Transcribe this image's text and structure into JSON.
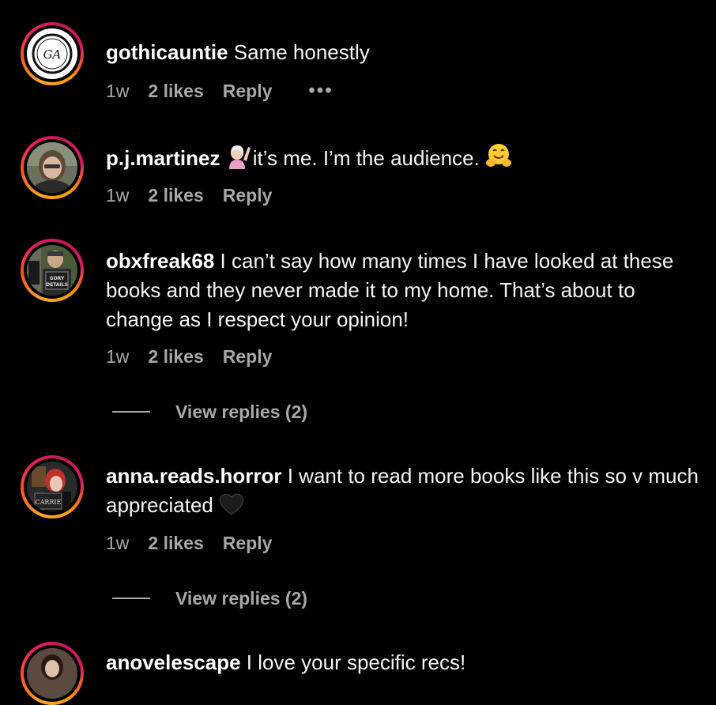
{
  "comments": [
    {
      "username": "gothicauntie",
      "text": " Same honestly",
      "time": "1w",
      "likes": "2 likes",
      "reply": "Reply",
      "more": "•••",
      "avatar_initials": "GA"
    },
    {
      "username": "p.j.martinez",
      "text_before_emoji": " ",
      "text": "it’s me. I’m the audience. ",
      "time": "1w",
      "likes": "2 likes",
      "reply": "Reply",
      "emojis": [
        "person-raising-hand-emoji",
        "hugging-face-emoji"
      ]
    },
    {
      "username": "obxfreak68",
      "text": " I can’t say how many times I have looked at these books and they never made it to my home. That’s about to change as I respect your opinion!",
      "time": "1w",
      "likes": "2 likes",
      "reply": "Reply",
      "view_replies": "View replies (2)",
      "avatar_text": "GORY DETAILS"
    },
    {
      "username": "anna.reads.horror",
      "text": " I want to read more books like this so v much appreciated ",
      "time": "1w",
      "likes": "2 likes",
      "reply": "Reply",
      "view_replies": "View replies (2)",
      "emojis": [
        "black-heart-emoji"
      ],
      "avatar_text": "CARRIE"
    },
    {
      "username": "anovelescape",
      "text": " I love your specific recs!"
    }
  ],
  "colors": {
    "background": "#000000",
    "text": "#f5f5f5",
    "meta": "#a8a8a8"
  }
}
